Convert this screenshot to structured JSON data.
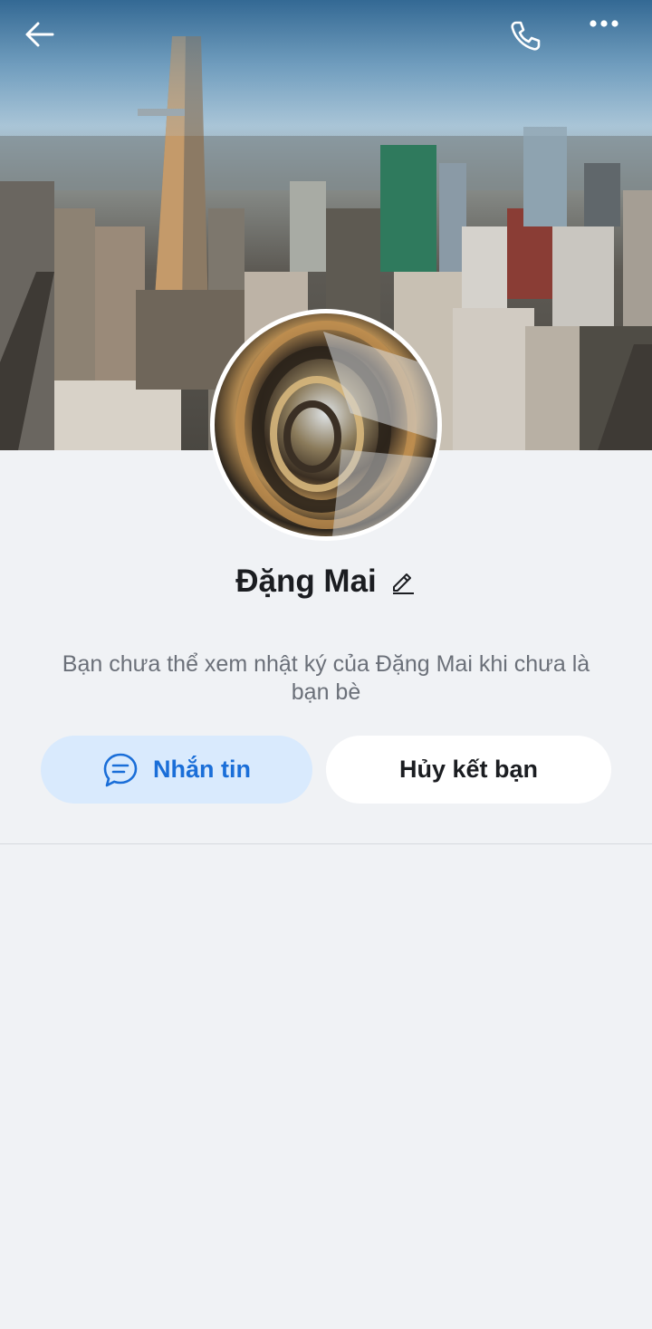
{
  "header": {
    "back_icon": "arrow-left-icon",
    "call_icon": "phone-icon",
    "more_icon": "more-horizontal-icon"
  },
  "profile": {
    "name": "Đặng Mai",
    "edit_icon": "pencil-icon",
    "privacy_notice": "Bạn chưa thể xem nhật ký của Đặng Mai khi chưa là bạn bè"
  },
  "actions": {
    "message_label": "Nhắn tin",
    "message_icon": "chat-bubble-icon",
    "unfriend_label": "Hủy kết bạn"
  },
  "colors": {
    "accent": "#1a6ed8",
    "accent_bg": "#d9eafd",
    "background": "#f0f2f5"
  }
}
